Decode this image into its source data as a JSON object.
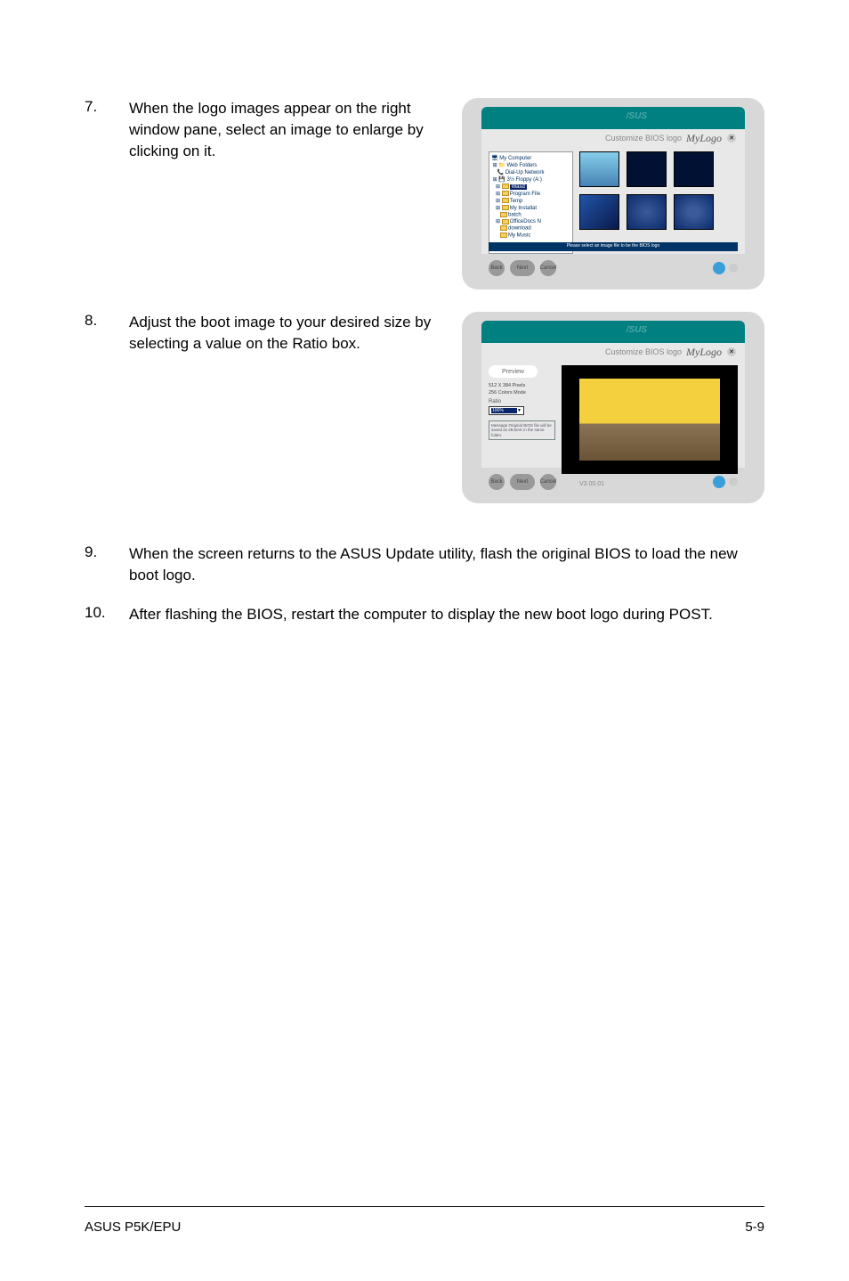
{
  "steps": {
    "s7": {
      "num": "7.",
      "text": "When the logo images appear on the right window pane, select an image to enlarge by clicking on it."
    },
    "s8": {
      "num": "8.",
      "text": "Adjust the boot image to your desired size by selecting a value on the Ratio box."
    },
    "s9": {
      "num": "9.",
      "text": "When the screen returns to the ASUS Update utility, flash the original BIOS to load the new boot logo."
    },
    "s10": {
      "num": "10.",
      "text": "After flashing the BIOS, restart the computer to display the new boot logo during POST."
    }
  },
  "screenshot1": {
    "asus": "/SUS",
    "mylogo_label": "Customize BIOS logo",
    "mylogo": "MyLogo",
    "tree": {
      "item0": "My Computer",
      "item1": "Web Folders",
      "item2": "Dial-Up Network",
      "item3": "3½ Floppy (A:)",
      "item4": "Wasd",
      "item5": "Program File",
      "item6": "Temp",
      "item7": "My Installat",
      "item8": "batch",
      "item9": "OfficeDocs N",
      "item10": "download",
      "item11": "My Music"
    },
    "status": "Please select an image file to be the BIOS logo",
    "nav": {
      "back": "Back",
      "next": "Next",
      "cancel": "Cancel"
    }
  },
  "screenshot2": {
    "asus": "/SUS",
    "mylogo_label": "Customize BIOS logo",
    "mylogo": "MyLogo",
    "preview_tab": "Preview",
    "resolution": "512 X 384 Pixels",
    "colormode": "256 Colors Mode",
    "ratio_label": "Ratio",
    "ratio_value": "100%",
    "message": "Message\nOriginal BIOS file will be saved as 2B.BAK in the same folder.",
    "version": "V3.00.01",
    "nav": {
      "back": "Back",
      "next": "Next",
      "cancel": "Cancel"
    }
  },
  "footer": {
    "left": "ASUS P5K/EPU",
    "right": "5-9"
  }
}
